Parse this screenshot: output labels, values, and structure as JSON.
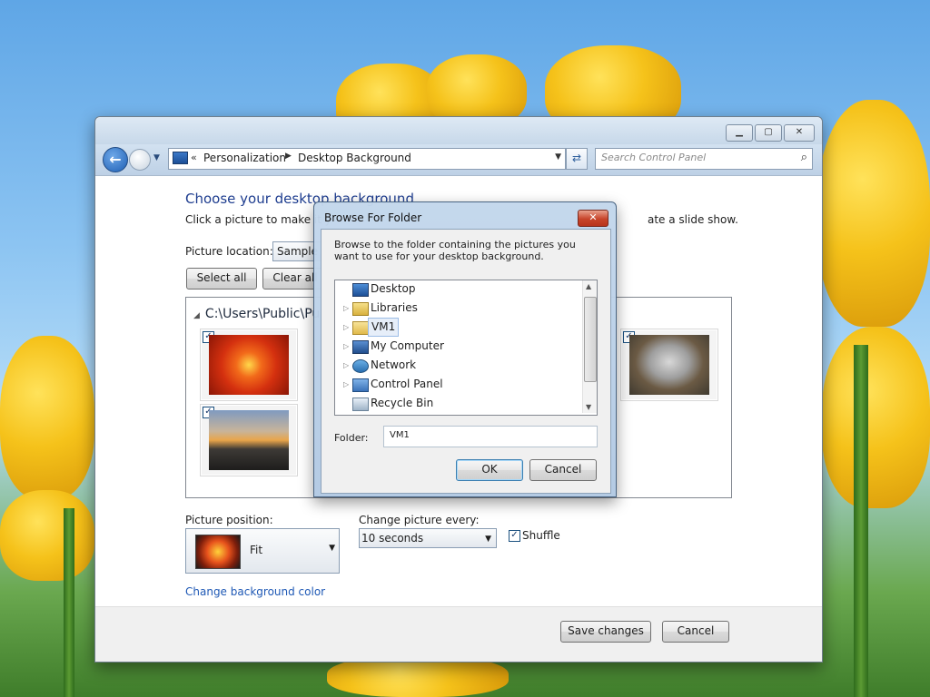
{
  "window": {
    "address": {
      "chevron": "«",
      "crumbs": [
        "Personalization",
        "Desktop Background"
      ]
    },
    "search_placeholder": "Search Control Panel",
    "caption_buttons": [
      "minimize",
      "maximize",
      "close"
    ]
  },
  "page": {
    "heading": "Choose your desktop background",
    "description_left": "Click a picture to make it y",
    "description_right": "ate a slide show.",
    "picture_location_label": "Picture location:",
    "picture_location_value": "Sample",
    "select_all": "Select all",
    "clear_all": "Clear all",
    "folder_path": "C:\\Users\\Public\\Pu",
    "thumbnails": [
      {
        "name": "flower",
        "checked": true
      },
      {
        "name": "koala",
        "checked": true
      },
      {
        "name": "lighthouse",
        "checked": true
      }
    ],
    "picture_position_label": "Picture position:",
    "picture_position_value": "Fit",
    "change_every_label": "Change picture every:",
    "change_every_value": "10 seconds",
    "shuffle_label": "Shuffle",
    "shuffle_checked": true,
    "change_bg_color": "Change background color",
    "save_changes": "Save changes",
    "cancel": "Cancel"
  },
  "dialog": {
    "title": "Browse For Folder",
    "instruction": "Browse to the folder containing the pictures you want to use for your desktop background.",
    "tree_items": [
      {
        "label": "Desktop",
        "icon": "desktop-icon",
        "expander": false,
        "selected": false
      },
      {
        "label": "Libraries",
        "icon": "libraries-icon",
        "expander": true,
        "selected": false
      },
      {
        "label": "VM1",
        "icon": "user-folder-icon",
        "expander": true,
        "selected": true
      },
      {
        "label": "My Computer",
        "icon": "computer-icon",
        "expander": true,
        "selected": false
      },
      {
        "label": "Network",
        "icon": "network-icon",
        "expander": true,
        "selected": false
      },
      {
        "label": "Control Panel",
        "icon": "control-panel-icon",
        "expander": true,
        "selected": false
      },
      {
        "label": "Recycle Bin",
        "icon": "recycle-bin-icon",
        "expander": false,
        "selected": false
      }
    ],
    "folder_label": "Folder:",
    "folder_value": "VM1",
    "ok": "OK",
    "cancel": "Cancel"
  }
}
